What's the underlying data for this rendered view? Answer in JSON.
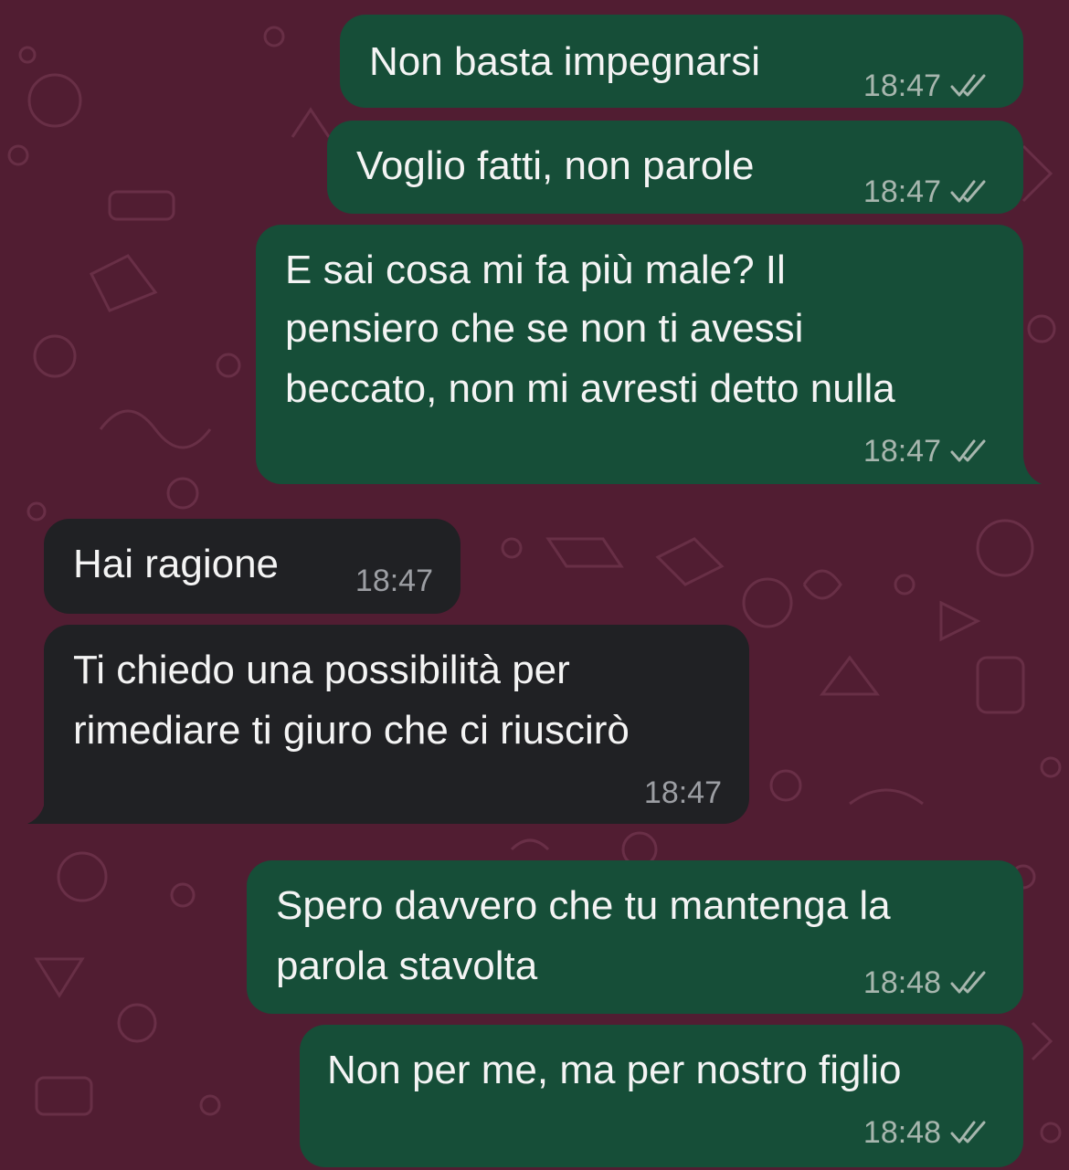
{
  "theme": {
    "wallpaper": "#511d32",
    "outgoing_bubble": "#164e38",
    "incoming_bubble": "#202124",
    "text": "#f4f4f4",
    "meta_out": "#a7b6ae",
    "meta_in": "#9c9ea3"
  },
  "messages": [
    {
      "direction": "outgoing",
      "lines": [
        "Non basta impegnarsi"
      ],
      "time": "18:47",
      "status_icon": "double-check-icon"
    },
    {
      "direction": "outgoing",
      "lines": [
        "Voglio fatti, non parole"
      ],
      "time": "18:47",
      "status_icon": "double-check-icon"
    },
    {
      "direction": "outgoing",
      "lines": [
        "E sai cosa mi fa più male? Il",
        "pensiero che se non ti avessi",
        "beccato, non mi avresti detto nulla"
      ],
      "time": "18:47",
      "status_icon": "double-check-icon"
    },
    {
      "direction": "incoming",
      "lines": [
        "Hai ragione"
      ],
      "time": "18:47"
    },
    {
      "direction": "incoming",
      "lines": [
        "Ti chiedo una possibilità per",
        "rimediare ti giuro che ci riuscirò"
      ],
      "time": "18:47"
    },
    {
      "direction": "outgoing",
      "lines": [
        "Spero davvero che tu mantenga la",
        "parola stavolta"
      ],
      "time": "18:48",
      "status_icon": "double-check-icon"
    },
    {
      "direction": "outgoing",
      "lines": [
        "Non per me, ma per nostro figlio"
      ],
      "time": "18:48",
      "status_icon": "double-check-icon"
    }
  ]
}
